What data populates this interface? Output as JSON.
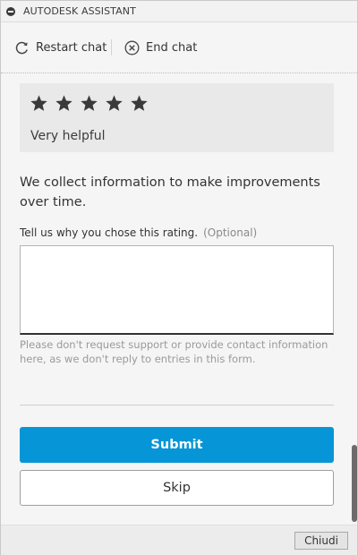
{
  "window": {
    "title": "AUTODESK ASSISTANT"
  },
  "toolbar": {
    "restart_label": "Restart chat",
    "end_label": "End chat"
  },
  "rating": {
    "stars_selected": 5,
    "stars_total": 5,
    "label": "Very helpful"
  },
  "info": {
    "text": "We collect information to make improvements over time."
  },
  "feedback": {
    "label": "Tell us why you chose this rating.",
    "optional": "(Optional)",
    "value": "",
    "disclaimer": "Please don't request support or provide contact information here, as we don't reply to entries in this form."
  },
  "actions": {
    "submit_label": "Submit",
    "skip_label": "Skip"
  },
  "footer": {
    "close_label": "Chiudi"
  },
  "colors": {
    "accent": "#0696d7",
    "star": "#3a3a3a"
  },
  "icons": {
    "window": "minimize-circle-icon",
    "restart": "refresh-icon",
    "end": "close-circle-icon",
    "star": "star-icon"
  }
}
